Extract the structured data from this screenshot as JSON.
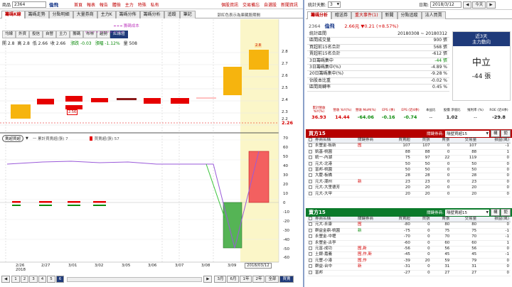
{
  "left": {
    "stock_label": "商品",
    "stock_code": "2364",
    "stock_name": "倫飛",
    "top_links": [
      "首頁",
      "報表",
      "報告",
      "體檢",
      "主力",
      "特殊",
      "私有"
    ],
    "right_links": [
      "個股資訊",
      "交易備忘",
      "自選股",
      "新聞資訊"
    ],
    "tabs": [
      "籌碼K線",
      "籌碼走勢",
      "分點明細",
      "大量券商",
      "主力K",
      "籌碼分佈",
      "籌碼分析",
      "追蹤",
      "筆記"
    ],
    "tab_note": "郭紅色表示為庫藏股期間",
    "indicator_toolbar": [
      "均線",
      "外資",
      "投信",
      "自營",
      "主力",
      "籌碼",
      "布林",
      "趨勢",
      "紅綠燈"
    ],
    "selected_indicator": "紅綠燈",
    "avg_cost_legend": "籌碼成本",
    "ohlc": {
      "open": "開 2.8",
      "high": "高 2.8",
      "low": "低 2.66",
      "close": "收 2.66"
    },
    "change_label": "漲跌 -0.03",
    "pct_label": "漲幅 -1.12%",
    "vol_label": "量 508",
    "price_ticks": [
      "2.8",
      "2.7",
      "2.6",
      "2.5",
      "2.4",
      "2.3",
      "2.2"
    ],
    "current_price_tag": "2.26",
    "bar_value_label_1": "2.8",
    "bar_value_label_2": "2.56",
    "lower_select": "賣超買超",
    "lower_legend_a": "一 累計買賣超(張) 7",
    "lower_legend_b": "買賣超(張) 57",
    "lower_ticks": [
      "70",
      "60",
      "50",
      "40",
      "30",
      "20",
      "10",
      "0",
      "-10",
      "-20",
      "-30",
      "-40",
      "-50",
      "-60"
    ],
    "dates": [
      "2/26",
      "2/27",
      "3/01",
      "3/02",
      "3/05",
      "3/06",
      "3/07",
      "3/08",
      "3/09",
      "3/12"
    ],
    "year_label": "2018",
    "highlight_date": "2018/03/12",
    "pager": [
      "1",
      "2",
      "3",
      "4",
      "5",
      "6"
    ],
    "pager_selected": "6",
    "range_buttons": [
      "3月",
      "6月",
      "1年",
      "2年",
      "全部"
    ],
    "range_selected": "買賣"
  },
  "right": {
    "stat_days_label": "統計天數:",
    "stat_days_value": "3",
    "date_label": "日期:",
    "date_value": "2018/3/12",
    "today_button": "今天",
    "tabs": [
      "籌碼分析",
      "贈送券",
      "重大事件(1)",
      "新聞",
      "分點追蹤",
      "法人買賣"
    ],
    "code": "2364",
    "name": "倫飛",
    "price_line": "2.66元 ▼0.21 (+8.57%)",
    "summary": [
      {
        "label": "統計區間",
        "value": "20180308 ~ 20180312"
      },
      {
        "label": "區間成交量",
        "value": "900 張"
      },
      {
        "label": "買超前15名合計",
        "value": "568 張"
      },
      {
        "label": "賣超前15名合計",
        "value": "-612 張"
      },
      {
        "label": "3日籌碼集中",
        "value": "-44 張",
        "color": "green"
      },
      {
        "label": "3日籌碼集中(%)",
        "value": "-4.89 %"
      },
      {
        "label": "20日籌碼集中(%)",
        "value": "-9.28 %"
      },
      {
        "label": "佔股本比重",
        "value": "-0.02 %"
      },
      {
        "label": "區間周轉率",
        "value": "0.45 %"
      }
    ],
    "side_box_title1": "近3天",
    "side_box_title2": "主力動向",
    "side_box_value": "中立",
    "side_box_shares": "-44 張",
    "metrics_headers": [
      "累計營收 YoY(%)",
      "營收 YoY(%)",
      "營收 MoM(%)",
      "EPS (季)",
      "EPS (近4季)",
      "本益比",
      "股價 淨值比",
      "殖利率 (%)",
      "ROE (近4季)"
    ],
    "metrics_values": [
      "36.93",
      "14.44",
      "-64.06",
      "-0.16",
      "-0.74",
      "--",
      "1.02",
      "--",
      "-29.8"
    ],
    "buy_title": "買方15",
    "buy_filter_label": "關鍵券商:",
    "buy_filter_value": "隔壁買超15",
    "sell_title": "賣方15",
    "sell_filter_label": "關鍵券商:",
    "sell_filter_value": "隔壁賣超15",
    "button_a": "構",
    "button_b": "鉅",
    "table_headers": [
      "券商名稱",
      "關鍵券商",
      "買賣超",
      "買張",
      "賣張",
      "交易量",
      "損益(萬)"
    ],
    "buy_rows": [
      {
        "name": "永豐金-板新",
        "key": "囿",
        "net": "107",
        "buy": "107",
        "sell": "0",
        "vol": "107",
        "pnl": "-1"
      },
      {
        "name": "凱基-桃園",
        "key": "",
        "net": "88",
        "buy": "88",
        "sell": "0",
        "vol": "88",
        "pnl": "1"
      },
      {
        "name": "統一-內湖",
        "key": "",
        "net": "75",
        "buy": "97",
        "sell": "22",
        "vol": "119",
        "pnl": "0"
      },
      {
        "name": "元大-北港",
        "key": "",
        "net": "50",
        "buy": "50",
        "sell": "0",
        "vol": "50",
        "pnl": "0"
      },
      {
        "name": "富邦-桃園",
        "key": "",
        "net": "50",
        "buy": "50",
        "sell": "0",
        "vol": "50",
        "pnl": "0"
      },
      {
        "name": "大慶-板橋",
        "key": "",
        "net": "28",
        "buy": "28",
        "sell": "0",
        "vol": "28",
        "pnl": "0"
      },
      {
        "name": "元大-潮州",
        "key": "新",
        "net": "23",
        "buy": "23",
        "sell": "0",
        "vol": "23",
        "pnl": "0"
      },
      {
        "name": "元大-大里德芳",
        "key": "",
        "net": "20",
        "buy": "20",
        "sell": "0",
        "vol": "20",
        "pnl": "0"
      },
      {
        "name": "元大-大甲",
        "key": "",
        "net": "20",
        "buy": "20",
        "sell": "0",
        "vol": "20",
        "pnl": "0"
      }
    ],
    "sell_rows": [
      {
        "name": "元大-永康",
        "key": "囿",
        "net": "-80",
        "buy": "0",
        "sell": "80",
        "vol": "80",
        "pnl": "0"
      },
      {
        "name": "群益金鼎-桃園",
        "key": "新",
        "net": "-75",
        "buy": "0",
        "sell": "75",
        "vol": "75",
        "pnl": "-1"
      },
      {
        "name": "永豐金-中壢",
        "key": "",
        "net": "-70",
        "buy": "0",
        "sell": "70",
        "vol": "70",
        "pnl": "-1"
      },
      {
        "name": "永豐金-古亭",
        "key": "",
        "net": "-60",
        "buy": "0",
        "sell": "60",
        "vol": "60",
        "pnl": "1"
      },
      {
        "name": "元富-成功",
        "key": "囿,新",
        "net": "-56",
        "buy": "0",
        "sell": "56",
        "vol": "56",
        "pnl": "0"
      },
      {
        "name": "土銀-嘉義",
        "key": "囿,作,新",
        "net": "-45",
        "buy": "0",
        "sell": "45",
        "vol": "45",
        "pnl": "-1"
      },
      {
        "name": "元豐-小港",
        "key": "囿,作",
        "net": "-39",
        "buy": "20",
        "sell": "59",
        "vol": "79",
        "pnl": "0"
      },
      {
        "name": "群益-台中",
        "key": "新",
        "net": "-31",
        "buy": "0",
        "sell": "31",
        "vol": "31",
        "pnl": "0"
      },
      {
        "name": "富邦",
        "key": "",
        "net": "-27",
        "buy": "0",
        "sell": "27",
        "vol": "27",
        "pnl": "0"
      }
    ]
  },
  "colors": {
    "up": "#e60000",
    "down": "#009a00",
    "accent": "#1f3a7a",
    "gold": "#f6b40e"
  }
}
